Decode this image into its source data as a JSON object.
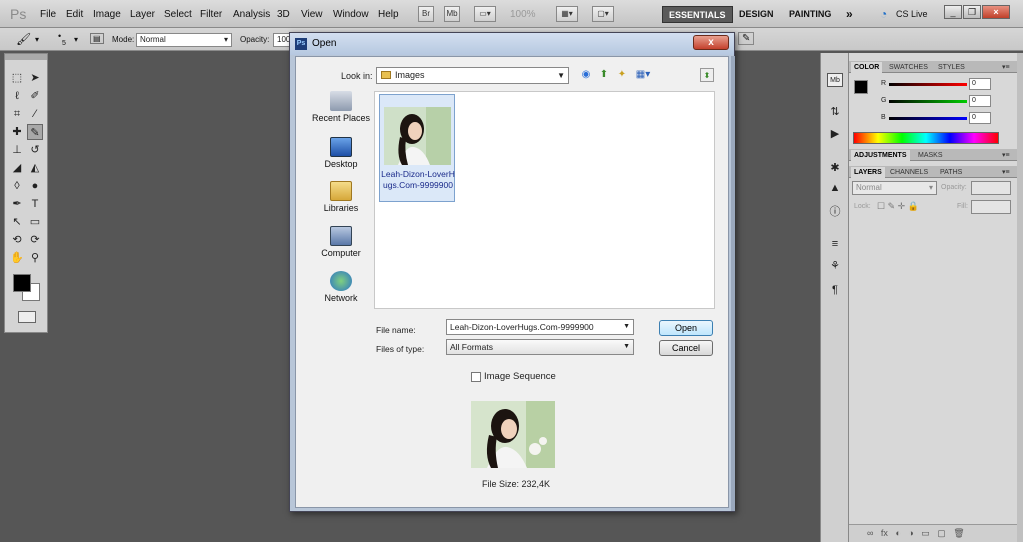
{
  "app": {
    "logo": "Ps",
    "menus": [
      "File",
      "Edit",
      "Image",
      "Layer",
      "Select",
      "Filter",
      "Analysis",
      "3D",
      "View",
      "Window",
      "Help"
    ],
    "bridge_btn": "Br",
    "minibridge_btn": "Mb",
    "zoom": "100%",
    "workspaces": [
      "ESSENTIALS",
      "DESIGN",
      "PAINTING"
    ],
    "more_workspaces": "»",
    "cs_live": "CS Live"
  },
  "options_bar": {
    "brush_size": "5",
    "mode_label": "Mode:",
    "mode_value": "Normal",
    "opacity_label": "Opacity:",
    "opacity_value": "100"
  },
  "panels": {
    "color_tabs": [
      "COLOR",
      "SWATCHES",
      "STYLES"
    ],
    "color": {
      "r_label": "R",
      "r_value": "0",
      "g_label": "G",
      "g_value": "0",
      "b_label": "B",
      "b_value": "0"
    },
    "adjust_tabs": [
      "ADJUSTMENTS",
      "MASKS"
    ],
    "layer_tabs": [
      "LAYERS",
      "CHANNELS",
      "PATHS"
    ],
    "blend_mode": "Normal",
    "opacity_label": "Opacity:",
    "lock_label": "Lock:",
    "fill_label": "Fill:"
  },
  "dialog": {
    "title": "Open",
    "close": "x",
    "look_in_label": "Look in:",
    "look_in_value": "Images",
    "places": [
      {
        "label": "Recent Places",
        "icon": "recent-places-icon"
      },
      {
        "label": "Desktop",
        "icon": "desktop-icon"
      },
      {
        "label": "Libraries",
        "icon": "libraries-icon"
      },
      {
        "label": "Computer",
        "icon": "computer-icon"
      },
      {
        "label": "Network",
        "icon": "network-icon"
      }
    ],
    "files": [
      {
        "name": "Leah-Dizon-LoverHugs.Com-9999900"
      }
    ],
    "file_name_label": "File name:",
    "file_name_value": "Leah-Dizon-LoverHugs.Com-9999900",
    "files_of_type_label": "Files of type:",
    "files_of_type_value": "All Formats",
    "open_button": "Open",
    "cancel_button": "Cancel",
    "image_sequence_label": "Image Sequence",
    "file_size": "File Size: 232,4K"
  }
}
